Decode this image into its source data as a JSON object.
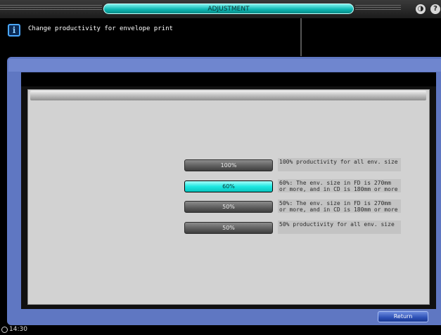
{
  "header": {
    "title": "ADJUSTMENT",
    "sound_icon": "speaker-icon",
    "help_icon": "help-icon",
    "help_glyph": "?"
  },
  "message": {
    "icon": "info-icon",
    "icon_glyph": "i",
    "text": "Change productivity for envelope print"
  },
  "options": [
    {
      "label": "100%",
      "selected": false,
      "description": "100% productivity for all env. size"
    },
    {
      "label": "60%",
      "selected": true,
      "description": "60%: The env. size in FD is 270mm\nor more, and in CD is 180mm or more"
    },
    {
      "label": "50%",
      "selected": false,
      "description": "50%: The env. size in FD is 270mm\nor more, and in CD is 180mm or more"
    },
    {
      "label": "50%",
      "selected": false,
      "description": "50% productivity for all env. size"
    }
  ],
  "footer": {
    "return_label": "Return"
  },
  "status": {
    "time": "14:30",
    "clock_icon": "clock-icon"
  },
  "colors": {
    "selected": "#1fe8e2",
    "frame": "#5f77c2",
    "panel": "#d2d2d2"
  }
}
